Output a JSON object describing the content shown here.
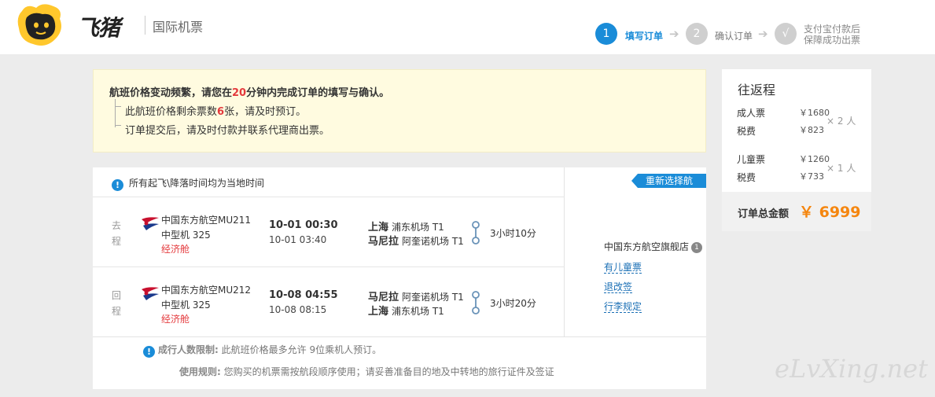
{
  "header": {
    "brand": "飞猪",
    "section_title": "国际机票",
    "steps": [
      {
        "num": "1",
        "label": "填写订单",
        "active": true
      },
      {
        "num": "2",
        "label": "确认订单",
        "active": false
      },
      {
        "num": "√",
        "label_line1": "支付宝付款后",
        "label_line2": "保障成功出票",
        "active": false
      }
    ]
  },
  "notice": {
    "main_prefix": "航班价格变动频繁，请您在",
    "main_minutes": "20",
    "main_suffix": "分钟内完成订单的填写与确认。",
    "line1_prefix": "此航班价格剩余票数",
    "line1_count": "6",
    "line1_suffix": "张，请及时预订。",
    "line2": "订单提交后，请及时付款并联系代理商出票。"
  },
  "flights": {
    "timezone_note": "所有起飞\\降落时间均为当地时间",
    "outbound": {
      "tag": "去程",
      "airline": "中国东方航空MU211",
      "plane": "中型机 325",
      "cabin": "经济舱",
      "dep_time": "10-01 00:30",
      "arr_time": "10-01 03:40",
      "dep_city": "上海",
      "dep_airport": "浦东机场 T1",
      "arr_city": "马尼拉",
      "arr_airport": "阿奎诺机场 T1",
      "duration": "3小时10分"
    },
    "return": {
      "tag": "回程",
      "airline": "中国东方航空MU212",
      "plane": "中型机 325",
      "cabin": "经济舱",
      "dep_time": "10-08 04:55",
      "arr_time": "10-08 08:15",
      "dep_city": "马尼拉",
      "dep_airport": "阿奎诺机场 T1",
      "arr_city": "上海",
      "arr_airport": "浦东机场 T1",
      "duration": "3小时20分"
    },
    "rebook_label": "重新选择航班",
    "store_name": "中国东方航空旗舰店",
    "store_badge": "1",
    "links": [
      "有儿童票",
      "退改签",
      "行李规定"
    ],
    "limit_label": "成行人数限制:",
    "limit_text": "此航班价格最多允许 9位乘机人预订。",
    "rule_label": "使用规则:",
    "rule_text": "您购买的机票需按航段顺序使用；请妥善准备目的地及中转地的旅行证件及签证"
  },
  "price": {
    "title": "往返程",
    "adult_label": "成人票",
    "adult_price": "￥1680",
    "adult_tax_label": "税费",
    "adult_tax": "￥823",
    "adult_count": "× 2 人",
    "child_label": "儿童票",
    "child_price": "￥1260",
    "child_tax_label": "税费",
    "child_tax": "￥733",
    "child_count": "× 1 人",
    "total_label": "订单总金额",
    "total_value": "￥ 6999"
  },
  "watermark": "eLvXing.net",
  "colors": {
    "accent_blue": "#1a8cd8",
    "highlight_red": "#e4393c",
    "total_orange": "#f5860f",
    "logo_yellow": "#ffc72c"
  }
}
